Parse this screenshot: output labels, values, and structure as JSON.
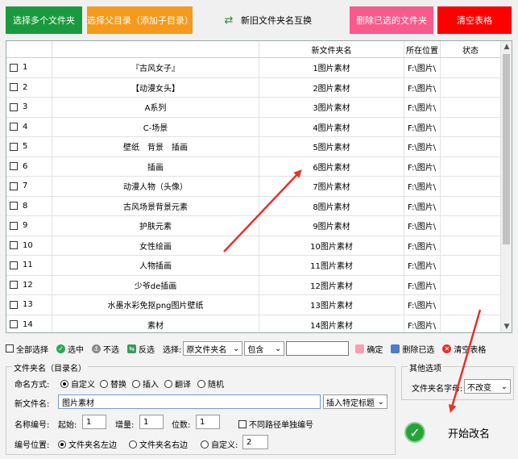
{
  "toolbar": {
    "select_folders": "选择多个文件夹",
    "select_parent": "选择父目录（添加子目录）",
    "swap_names": "新旧文件夹名互换",
    "remove_selected": "删除已选的文件夹",
    "clear_table": "清空表格"
  },
  "grid": {
    "headers": [
      "",
      "",
      "新文件夹名",
      "所在位置",
      "状态"
    ],
    "rows": [
      {
        "num": "1",
        "old": "『古风女子』",
        "new": "1图片素材",
        "loc": "F:\\图片\\"
      },
      {
        "num": "2",
        "old": "【动漫女头】",
        "new": "2图片素材",
        "loc": "F:\\图片\\"
      },
      {
        "num": "3",
        "old": "A系列",
        "new": "3图片素材",
        "loc": "F:\\图片\\"
      },
      {
        "num": "4",
        "old": "C-场景",
        "new": "4图片素材",
        "loc": "F:\\图片\\"
      },
      {
        "num": "5",
        "old": "壁纸　背景　插画",
        "new": "5图片素材",
        "loc": "F:\\图片\\"
      },
      {
        "num": "6",
        "old": "插画",
        "new": "6图片素材",
        "loc": "F:\\图片\\"
      },
      {
        "num": "7",
        "old": "动漫人物（头像）",
        "new": "7图片素材",
        "loc": "F:\\图片\\"
      },
      {
        "num": "8",
        "old": "古风场景背景元素",
        "new": "8图片素材",
        "loc": "F:\\图片\\"
      },
      {
        "num": "9",
        "old": "护肤元素",
        "new": "9图片素材",
        "loc": "F:\\图片\\"
      },
      {
        "num": "10",
        "old": "女性绘画",
        "new": "10图片素材",
        "loc": "F:\\图片\\"
      },
      {
        "num": "11",
        "old": "人物插画",
        "new": "11图片素材",
        "loc": "F:\\图片\\"
      },
      {
        "num": "12",
        "old": "少爷de插画",
        "new": "12图片素材",
        "loc": "F:\\图片\\"
      },
      {
        "num": "13",
        "old": "水墨水彩免抠png图片壁纸",
        "new": "13图片素材",
        "loc": "F:\\图片\\"
      },
      {
        "num": "14",
        "old": "素材",
        "new": "14图片素材",
        "loc": "F:\\图片\\"
      }
    ]
  },
  "actions": {
    "select_all": "全部选择",
    "check": "选中",
    "uncheck": "不选",
    "invert": "反选",
    "choose_label": "选择:",
    "field_value": "原文件夹名",
    "match_value": "包含",
    "confirm": "确定",
    "delete_selected": "删除已选",
    "clear": "清空表格"
  },
  "naming": {
    "legend": "文件夹名（目录名）",
    "mode_label": "命名方式:",
    "modes": [
      "自定义",
      "替换",
      "插入",
      "翻译",
      "随机"
    ],
    "new_name_label": "新文件名:",
    "new_name_value": "图片素材",
    "insert_tag": "插入特定标题",
    "numbering_label": "名称编号:",
    "start_label": "起始:",
    "start_value": "1",
    "increment_label": "增量:",
    "increment_value": "1",
    "digits_label": "位数:",
    "digits_value": "1",
    "independent_label": "不同路径单独编号",
    "position_label": "编号位置:",
    "pos_left": "文件夹名左边",
    "pos_right": "文件夹名右边",
    "pos_custom": "自定义:",
    "pos_custom_value": "2"
  },
  "other": {
    "legend": "其他选项",
    "case_label": "文件夹名字母:",
    "case_value": "不改变"
  },
  "start": {
    "label": "开始改名"
  },
  "colors": {
    "green": "#1a9a3e",
    "orange": "#f59a1c",
    "pink": "#f75a8d",
    "red": "#ff0000",
    "annotation": "#e8322a"
  }
}
